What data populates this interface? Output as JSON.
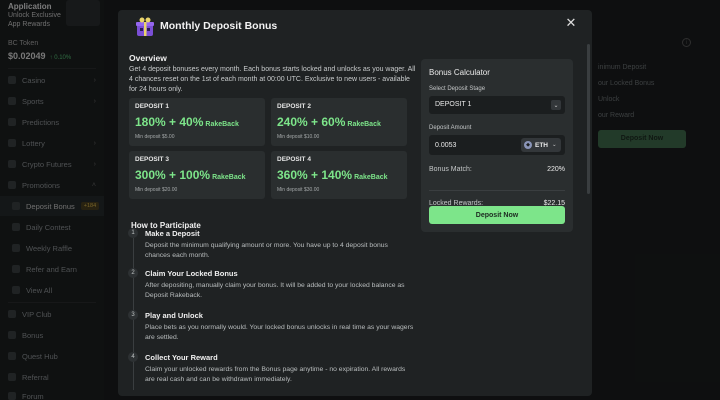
{
  "app": {
    "title": "Application",
    "subtitle_line1": "Unlock Exclusive",
    "subtitle_line2": "App Rewards"
  },
  "token": {
    "name": "BC Token",
    "price": "$0.02049",
    "change": "↑ 0.10%"
  },
  "sidebar": {
    "items": [
      {
        "label": "Casino"
      },
      {
        "label": "Sports"
      },
      {
        "label": "Predictions"
      },
      {
        "label": "Lottery"
      },
      {
        "label": "Crypto Futures"
      },
      {
        "label": "Promotions"
      }
    ],
    "sub_items": [
      {
        "label": "Deposit Bonus",
        "badge": "+184"
      },
      {
        "label": "Daily Contest"
      },
      {
        "label": "Weekly Raffle"
      },
      {
        "label": "Refer and Earn"
      },
      {
        "label": "View All"
      }
    ],
    "bottom_items": [
      {
        "label": "VIP Club"
      },
      {
        "label": "Bonus"
      },
      {
        "label": "Quest Hub"
      },
      {
        "label": "Referral"
      },
      {
        "label": "Forum"
      }
    ]
  },
  "background": {
    "line1": "inimum Deposit",
    "line2": "our Locked Bonus",
    "line3": "Unlock",
    "line4": "our Reward",
    "button": "Deposit Now"
  },
  "modal": {
    "title": "Monthly Deposit Bonus",
    "overview_heading": "Overview",
    "overview_text": "Get 4 deposit bonuses every month. Each bonus starts locked and unlocks as you wager. All 4 chances reset on the 1st of each month at 00:00 UTC. Exclusive to new users - available for 24 hours only.",
    "deposits": [
      {
        "label": "DEPOSIT 1",
        "percent": "180% + 40%",
        "rakeback": "RakeBack",
        "min": "Min deposit $5.00"
      },
      {
        "label": "DEPOSIT 2",
        "percent": "240% + 60%",
        "rakeback": "RakeBack",
        "min": "Min deposit $10.00"
      },
      {
        "label": "DEPOSIT 3",
        "percent": "300% + 100%",
        "rakeback": "RakeBack",
        "min": "Min deposit $20.00"
      },
      {
        "label": "DEPOSIT 4",
        "percent": "360% + 140%",
        "rakeback": "RakeBack",
        "min": "Min deposit $30.00"
      }
    ],
    "how_heading": "How to Participate",
    "steps": [
      {
        "num": "1",
        "title": "Make a Deposit",
        "desc": "Deposit the minimum qualifying amount or more. You have up to 4 deposit bonus chances each month."
      },
      {
        "num": "2",
        "title": "Claim Your Locked Bonus",
        "desc": "After depositing, manually claim your bonus. It will be added to your locked balance as Deposit Rakeback."
      },
      {
        "num": "3",
        "title": "Play and Unlock",
        "desc": "Place bets as you normally would. Your locked bonus unlocks in real time as your wagers are settled."
      },
      {
        "num": "4",
        "title": "Collect Your Reward",
        "desc": "Claim your unlocked rewards from the Bonus page anytime - no expiration. All rewards are real cash and can be withdrawn immediately."
      }
    ],
    "calculator": {
      "title": "Bonus Calculator",
      "stage_label": "Select Deposit Stage",
      "stage_value": "DEPOSIT 1",
      "amount_label": "Deposit Amount",
      "amount_value": "0.0053",
      "currency": "ETH",
      "match_label": "Bonus Match:",
      "match_value": "220%",
      "locked_label": "Locked Rewards:",
      "locked_value": "$22.15",
      "button": "Deposit Now"
    }
  },
  "colors": {
    "accent": "#7de58a",
    "modal_bg": "#1f2223",
    "card_bg": "#2a2e2f"
  }
}
